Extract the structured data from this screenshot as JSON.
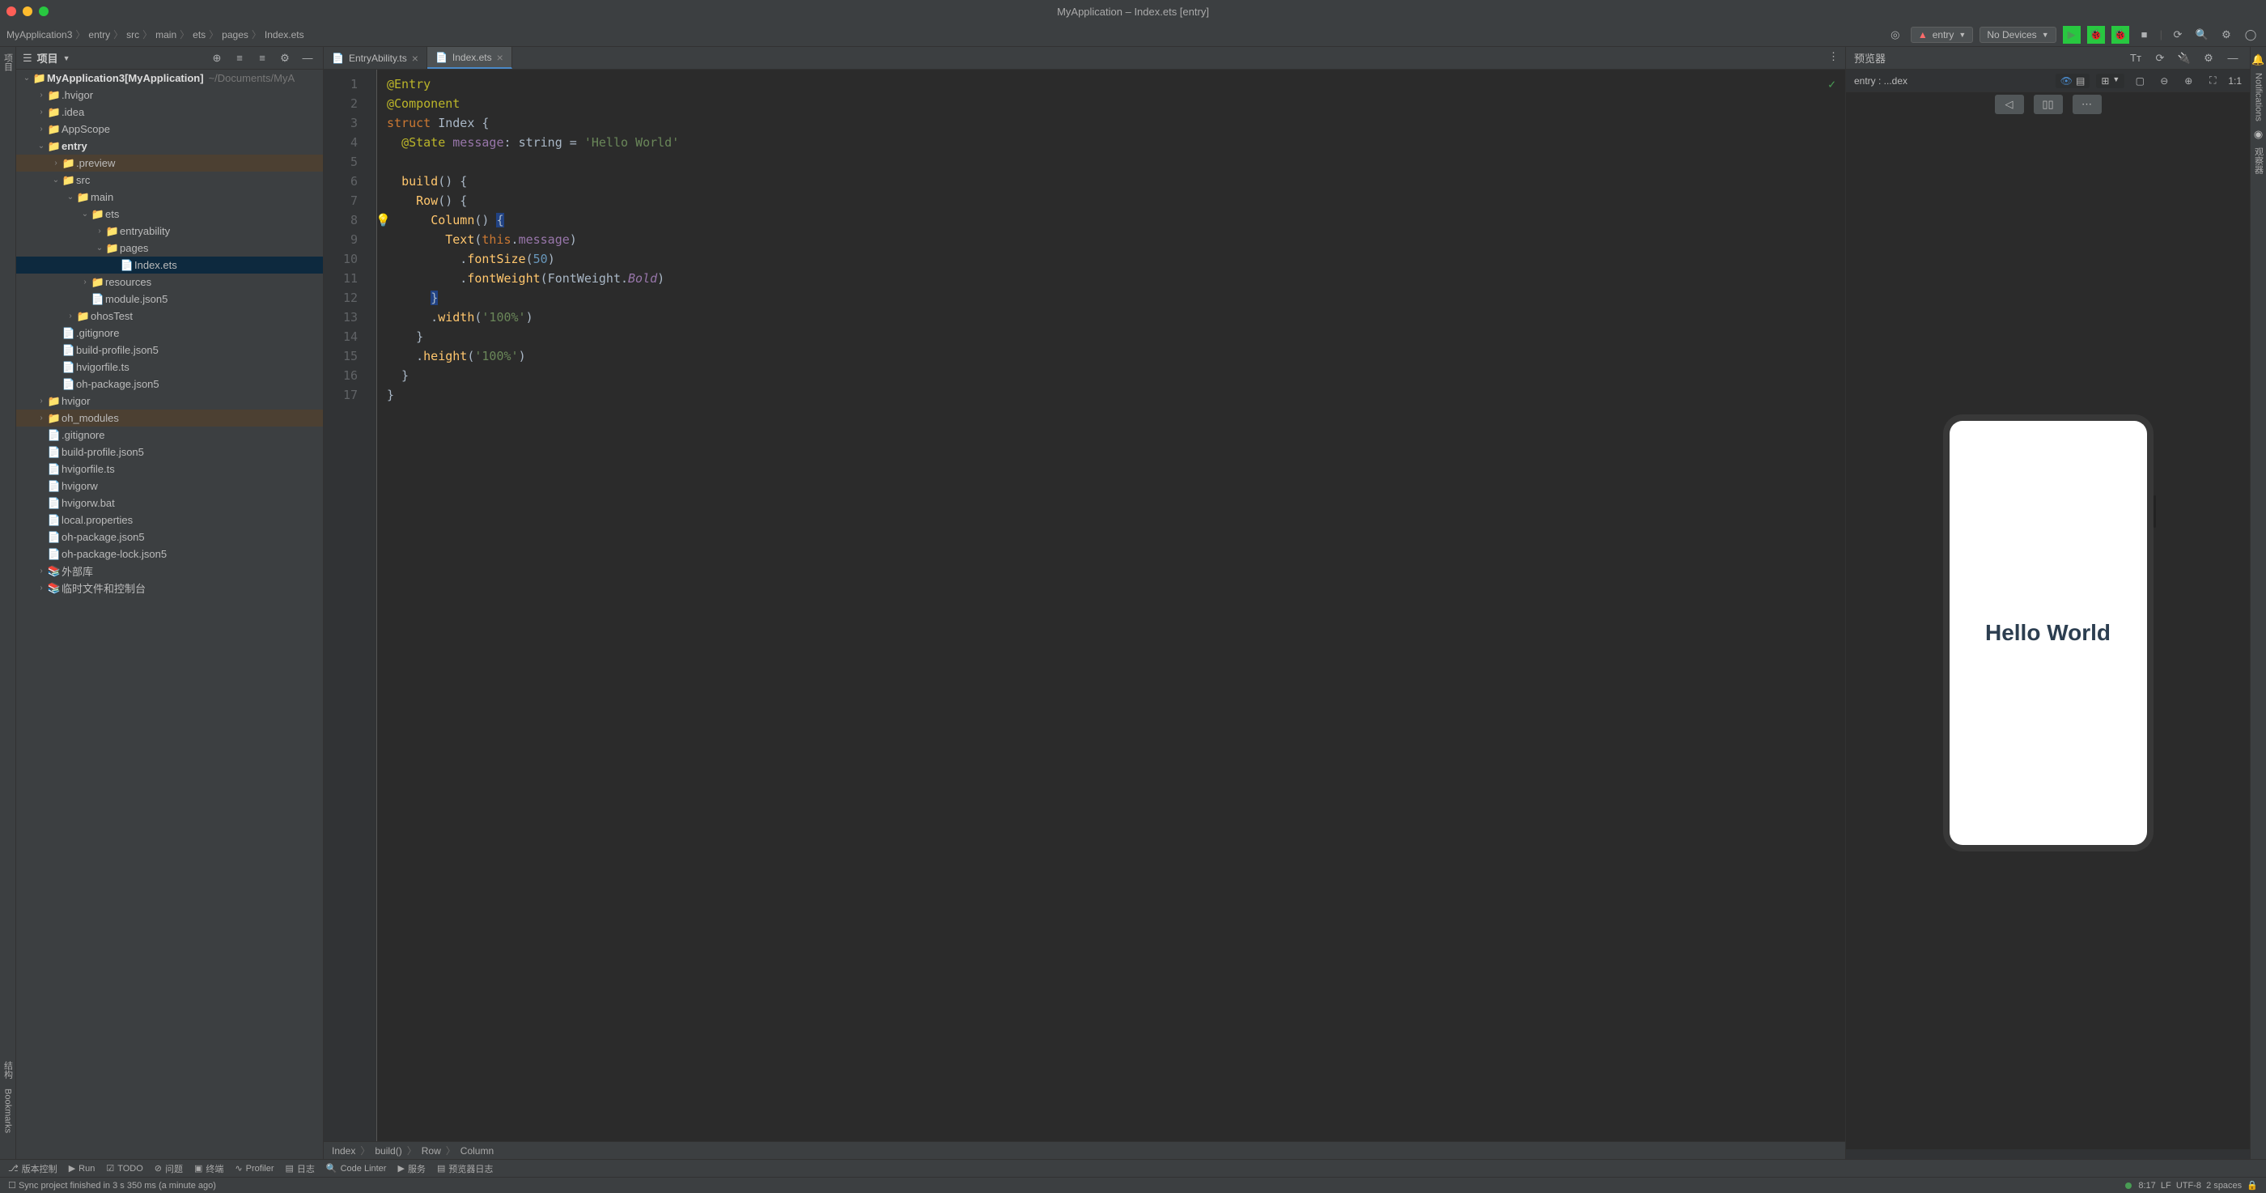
{
  "title": "MyApplication – Index.ets [entry]",
  "breadcrumbs": [
    "MyApplication3",
    "entry",
    "src",
    "main",
    "ets",
    "pages",
    "Index.ets"
  ],
  "toolbar": {
    "module": "entry",
    "device": "No Devices"
  },
  "project_panel": {
    "title": "项目"
  },
  "tree": {
    "root": "MyApplication3",
    "root_tag": "[MyApplication]",
    "root_path": "~/Documents/MyA",
    "items": [
      {
        "depth": 1,
        "arrow": "›",
        "icon": "folder",
        "label": ".hvigor"
      },
      {
        "depth": 1,
        "arrow": "›",
        "icon": "folder",
        "label": ".idea"
      },
      {
        "depth": 1,
        "arrow": "›",
        "icon": "folder",
        "label": "AppScope"
      },
      {
        "depth": 1,
        "arrow": "⌄",
        "icon": "folder",
        "label": "entry",
        "bold": true
      },
      {
        "depth": 2,
        "arrow": "›",
        "icon": "folder-o",
        "label": ".preview",
        "hl": true
      },
      {
        "depth": 2,
        "arrow": "⌄",
        "icon": "folder",
        "label": "src"
      },
      {
        "depth": 3,
        "arrow": "⌄",
        "icon": "folder",
        "label": "main"
      },
      {
        "depth": 4,
        "arrow": "⌄",
        "icon": "folder",
        "label": "ets"
      },
      {
        "depth": 5,
        "arrow": "›",
        "icon": "folder",
        "label": "entryability"
      },
      {
        "depth": 5,
        "arrow": "⌄",
        "icon": "folder",
        "label": "pages"
      },
      {
        "depth": 6,
        "arrow": "",
        "icon": "file",
        "label": "Index.ets",
        "sel": true
      },
      {
        "depth": 4,
        "arrow": "›",
        "icon": "folder",
        "label": "resources"
      },
      {
        "depth": 4,
        "arrow": "",
        "icon": "file",
        "label": "module.json5"
      },
      {
        "depth": 3,
        "arrow": "›",
        "icon": "folder",
        "label": "ohosTest"
      },
      {
        "depth": 2,
        "arrow": "",
        "icon": "file",
        "label": ".gitignore"
      },
      {
        "depth": 2,
        "arrow": "",
        "icon": "file",
        "label": "build-profile.json5"
      },
      {
        "depth": 2,
        "arrow": "",
        "icon": "file",
        "label": "hvigorfile.ts"
      },
      {
        "depth": 2,
        "arrow": "",
        "icon": "file",
        "label": "oh-package.json5"
      },
      {
        "depth": 1,
        "arrow": "›",
        "icon": "folder",
        "label": "hvigor"
      },
      {
        "depth": 1,
        "arrow": "›",
        "icon": "folder-o",
        "label": "oh_modules",
        "hl": true
      },
      {
        "depth": 1,
        "arrow": "",
        "icon": "file",
        "label": ".gitignore"
      },
      {
        "depth": 1,
        "arrow": "",
        "icon": "file",
        "label": "build-profile.json5"
      },
      {
        "depth": 1,
        "arrow": "",
        "icon": "file",
        "label": "hvigorfile.ts"
      },
      {
        "depth": 1,
        "arrow": "",
        "icon": "file",
        "label": "hvigorw"
      },
      {
        "depth": 1,
        "arrow": "",
        "icon": "file",
        "label": "hvigorw.bat"
      },
      {
        "depth": 1,
        "arrow": "",
        "icon": "file",
        "label": "local.properties"
      },
      {
        "depth": 1,
        "arrow": "",
        "icon": "file",
        "label": "oh-package.json5"
      },
      {
        "depth": 1,
        "arrow": "",
        "icon": "file",
        "label": "oh-package-lock.json5"
      }
    ],
    "ext_lib": "外部库",
    "scratch": "临时文件和控制台"
  },
  "tabs": [
    {
      "label": "EntryAbility.ts",
      "active": false
    },
    {
      "label": "Index.ets",
      "active": true
    }
  ],
  "code": {
    "lines": [
      {
        "n": 1,
        "html": "<span class='ann'>@Entry</span>"
      },
      {
        "n": 2,
        "html": "<span class='ann'>@Component</span>"
      },
      {
        "n": 3,
        "html": "<span class='kw'>struct</span> <span class='type'>Index</span> {"
      },
      {
        "n": 4,
        "html": "&nbsp;&nbsp;<span class='ann'>@State</span> <span class='prop'>message</span>: <span class='type'>string</span> = <span class='str'>'Hello World'</span>"
      },
      {
        "n": 5,
        "html": ""
      },
      {
        "n": 6,
        "html": "&nbsp;&nbsp;<span class='fn'>build</span>() {"
      },
      {
        "n": 7,
        "html": "&nbsp;&nbsp;&nbsp;&nbsp;<span class='fn'>Row</span>() {"
      },
      {
        "n": 8,
        "html": "&nbsp;&nbsp;&nbsp;&nbsp;&nbsp;&nbsp;<span class='fn'>Column</span>() <span style='background:#214283'>{</span>"
      },
      {
        "n": 9,
        "html": "&nbsp;&nbsp;&nbsp;&nbsp;&nbsp;&nbsp;&nbsp;&nbsp;<span class='fn'>Text</span>(<span class='kw'>this</span>.<span class='prop'>message</span>)"
      },
      {
        "n": 10,
        "html": "&nbsp;&nbsp;&nbsp;&nbsp;&nbsp;&nbsp;&nbsp;&nbsp;&nbsp;&nbsp;.<span class='fn'>fontSize</span>(<span class='num'>50</span>)"
      },
      {
        "n": 11,
        "html": "&nbsp;&nbsp;&nbsp;&nbsp;&nbsp;&nbsp;&nbsp;&nbsp;&nbsp;&nbsp;.<span class='fn'>fontWeight</span>(<span class='type'>FontWeight</span>.<span class='bold-purple'>Bold</span>)"
      },
      {
        "n": 12,
        "html": "&nbsp;&nbsp;&nbsp;&nbsp;&nbsp;&nbsp;<span style='background:#214283'>}</span>"
      },
      {
        "n": 13,
        "html": "&nbsp;&nbsp;&nbsp;&nbsp;&nbsp;&nbsp;.<span class='fn'>width</span>(<span class='str'>'100%'</span>)"
      },
      {
        "n": 14,
        "html": "&nbsp;&nbsp;&nbsp;&nbsp;}"
      },
      {
        "n": 15,
        "html": "&nbsp;&nbsp;&nbsp;&nbsp;.<span class='fn'>height</span>(<span class='str'>'100%'</span>)"
      },
      {
        "n": 16,
        "html": "&nbsp;&nbsp;}"
      },
      {
        "n": 17,
        "html": "}"
      }
    ]
  },
  "struct_crumbs": [
    "Index",
    "build()",
    "Row",
    "Column"
  ],
  "previewer": {
    "title": "预览器",
    "entry": "entry : ...dex",
    "ratio": "1:1",
    "text": "Hello World"
  },
  "left_tabs": {
    "project": "项目",
    "structure": "结构",
    "bookmarks": "Bookmarks"
  },
  "right_tabs": {
    "notifications": "Notifications",
    "inspector": "观察器"
  },
  "bottom": {
    "version": "版本控制",
    "run": "Run",
    "todo": "TODO",
    "problems": "问题",
    "terminal": "终端",
    "profiler": "Profiler",
    "log": "日志",
    "linter": "Code Linter",
    "services": "服务",
    "prev_log": "预览器日志"
  },
  "status": {
    "msg": "Sync project finished in 3 s 350 ms (a minute ago)",
    "pos": "8:17",
    "eol": "LF",
    "enc": "UTF-8",
    "indent": "2 spaces"
  }
}
